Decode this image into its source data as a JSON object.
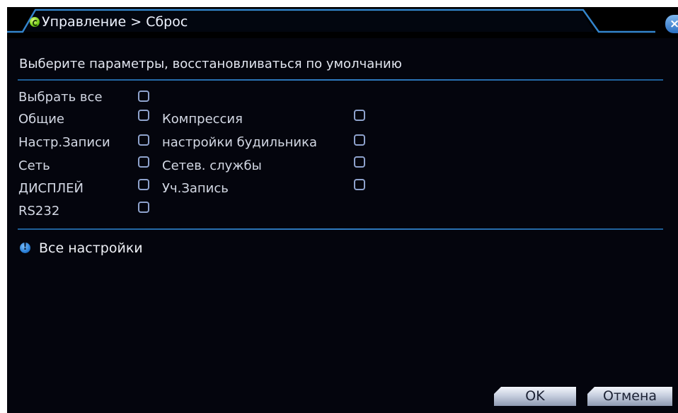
{
  "title": {
    "text": "Управление > Сброс",
    "icon": "restore-icon",
    "close_label": "×"
  },
  "header_text": "Выберите параметры, восстановливаться по умолчанию",
  "options": {
    "select_all": "Выбрать все",
    "general": "Общие",
    "compression": "Компрессия",
    "record_settings": "Настр.Записи",
    "alarm_settings": "настройки будильника",
    "network": "Сеть",
    "network_services": "Сетев. службы",
    "display": "ДИСПЛЕЙ",
    "account": "Уч.Запись",
    "rs232": "RS232"
  },
  "info": {
    "icon": "info-icon",
    "text": "Все настройки"
  },
  "buttons": {
    "ok": "OK",
    "cancel": "Отмена"
  },
  "colors": {
    "background": "#04050d",
    "divider": "#2f7bc0",
    "tab_border": "#2f7bc0",
    "text": "#d3d8e4",
    "checkbox_border": "#8ea2cc"
  }
}
